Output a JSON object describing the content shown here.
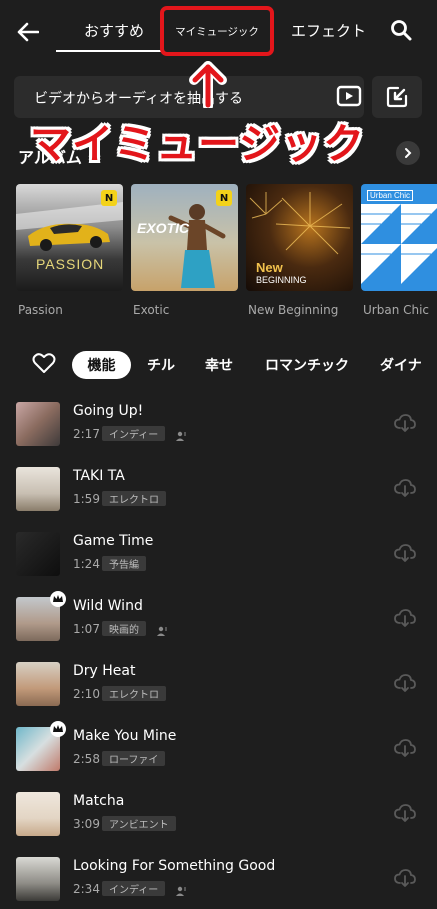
{
  "header": {
    "back_icon": "back-arrow-icon",
    "tabs": [
      "おすすめ",
      "マイミュージック",
      "エフェクト"
    ],
    "search_icon": "search-icon",
    "highlight_color": "#e3161b"
  },
  "video_to_audio": {
    "label": "ビデオからオーディオを抽出する",
    "icon": "video-play-icon",
    "import_icon": "import-icon"
  },
  "annotation": {
    "label": "マイミュージック",
    "color": "#e3161b"
  },
  "albums": {
    "title": "アルバム",
    "items": [
      {
        "name": "Passion",
        "cover_text": "PASSION",
        "badge": "N"
      },
      {
        "name": "Exotic",
        "cover_text": "EXOTIC",
        "badge": "N"
      },
      {
        "name": "New Beginning",
        "cover_text": "New",
        "cover_sub": "BEGINNING"
      },
      {
        "name": "Urban Chic",
        "cover_text": "Urban Chic"
      }
    ]
  },
  "filters": {
    "heart_icon": "heart-icon",
    "chips": [
      "機能",
      "チル",
      "幸せ",
      "ロマンチック",
      "ダイナ"
    ],
    "active_index": 0
  },
  "tracks": [
    {
      "title": "Going Up!",
      "duration": "2:17",
      "genre": "インディー",
      "artist_icon": true,
      "premium": false
    },
    {
      "title": "TAKI TA",
      "duration": "1:59",
      "genre": "エレクトロ",
      "artist_icon": false,
      "premium": false
    },
    {
      "title": "Game Time",
      "duration": "1:24",
      "genre": "予告編",
      "artist_icon": false,
      "premium": false
    },
    {
      "title": "Wild Wind",
      "duration": "1:07",
      "genre": "映画的",
      "artist_icon": true,
      "premium": true
    },
    {
      "title": "Dry Heat",
      "duration": "2:10",
      "genre": "エレクトロ",
      "artist_icon": false,
      "premium": false
    },
    {
      "title": "Make You Mine",
      "duration": "2:58",
      "genre": "ローファイ",
      "artist_icon": false,
      "premium": true
    },
    {
      "title": "Matcha",
      "duration": "3:09",
      "genre": "アンビエント",
      "artist_icon": false,
      "premium": false
    },
    {
      "title": "Looking For Something Good",
      "duration": "2:34",
      "genre": "インディー",
      "artist_icon": true,
      "premium": false
    }
  ]
}
